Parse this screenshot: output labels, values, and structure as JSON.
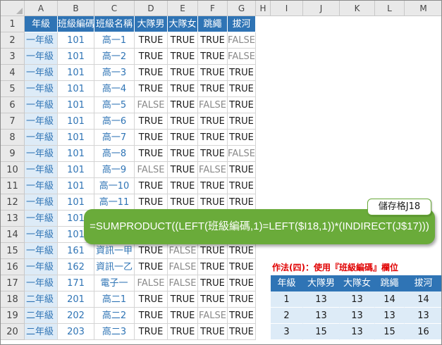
{
  "columns": [
    "A",
    "B",
    "C",
    "D",
    "E",
    "F",
    "G",
    "H",
    "I",
    "J",
    "K",
    "L",
    "M"
  ],
  "rows": [
    "1",
    "2",
    "3",
    "4",
    "5",
    "6",
    "7",
    "8",
    "9",
    "10",
    "11",
    "12",
    "13",
    "14",
    "15",
    "16",
    "17",
    "18",
    "19",
    "20"
  ],
  "header": [
    "年級",
    "班級編碼",
    "班級名稱",
    "大隊男",
    "大隊女",
    "跳繩",
    "拔河"
  ],
  "data": [
    [
      "一年級",
      "101",
      "高一1",
      "TRUE",
      "TRUE",
      "TRUE",
      "FALSE"
    ],
    [
      "一年級",
      "101",
      "高一2",
      "TRUE",
      "TRUE",
      "TRUE",
      "FALSE"
    ],
    [
      "一年級",
      "101",
      "高一3",
      "TRUE",
      "TRUE",
      "TRUE",
      "TRUE"
    ],
    [
      "一年級",
      "101",
      "高一4",
      "TRUE",
      "TRUE",
      "TRUE",
      "TRUE"
    ],
    [
      "一年級",
      "101",
      "高一5",
      "FALSE",
      "TRUE",
      "FALSE",
      "TRUE"
    ],
    [
      "一年級",
      "101",
      "高一6",
      "TRUE",
      "TRUE",
      "TRUE",
      "TRUE"
    ],
    [
      "一年級",
      "101",
      "高一7",
      "TRUE",
      "TRUE",
      "TRUE",
      "TRUE"
    ],
    [
      "一年級",
      "101",
      "高一8",
      "TRUE",
      "TRUE",
      "TRUE",
      "FALSE"
    ],
    [
      "一年級",
      "101",
      "高一9",
      "FALSE",
      "TRUE",
      "FALSE",
      "TRUE"
    ],
    [
      "一年級",
      "101",
      "高一10",
      "TRUE",
      "TRUE",
      "TRUE",
      "TRUE"
    ],
    [
      "一年級",
      "101",
      "高一11",
      "TRUE",
      "TRUE",
      "TRUE",
      "TRUE"
    ],
    [
      "一年級",
      "101",
      "",
      "",
      "",
      "",
      ""
    ],
    [
      "一年級",
      "101",
      "",
      "",
      "",
      "",
      ""
    ],
    [
      "一年級",
      "161",
      "資訊一甲",
      "TRUE",
      "FALSE",
      "TRUE",
      "TRUE"
    ],
    [
      "一年級",
      "162",
      "資訊一乙",
      "TRUE",
      "FALSE",
      "TRUE",
      "TRUE"
    ],
    [
      "一年級",
      "171",
      "電子一",
      "FALSE",
      "FALSE",
      "TRUE",
      "TRUE"
    ],
    [
      "二年級",
      "201",
      "高二1",
      "TRUE",
      "TRUE",
      "TRUE",
      "TRUE"
    ],
    [
      "二年級",
      "202",
      "高二2",
      "TRUE",
      "TRUE",
      "FALSE",
      "TRUE"
    ],
    [
      "二年級",
      "203",
      "高二3",
      "TRUE",
      "TRUE",
      "TRUE",
      "TRUE"
    ]
  ],
  "summary": {
    "header": [
      "年級",
      "大隊男",
      "大隊女",
      "跳繩",
      "拔河"
    ],
    "rows": [
      [
        "1",
        "13",
        "13",
        "14",
        "14"
      ],
      [
        "2",
        "13",
        "13",
        "13",
        "13"
      ],
      [
        "3",
        "15",
        "13",
        "15",
        "16"
      ]
    ]
  },
  "note": "作法(四)：使用『班級編碼』欄位",
  "callout": {
    "cell_tag": "儲存格J18",
    "formula": "=SUMPRODUCT((LEFT(班級編碼,1)=LEFT($I18,1))*(INDIRECT(J$17)))"
  }
}
